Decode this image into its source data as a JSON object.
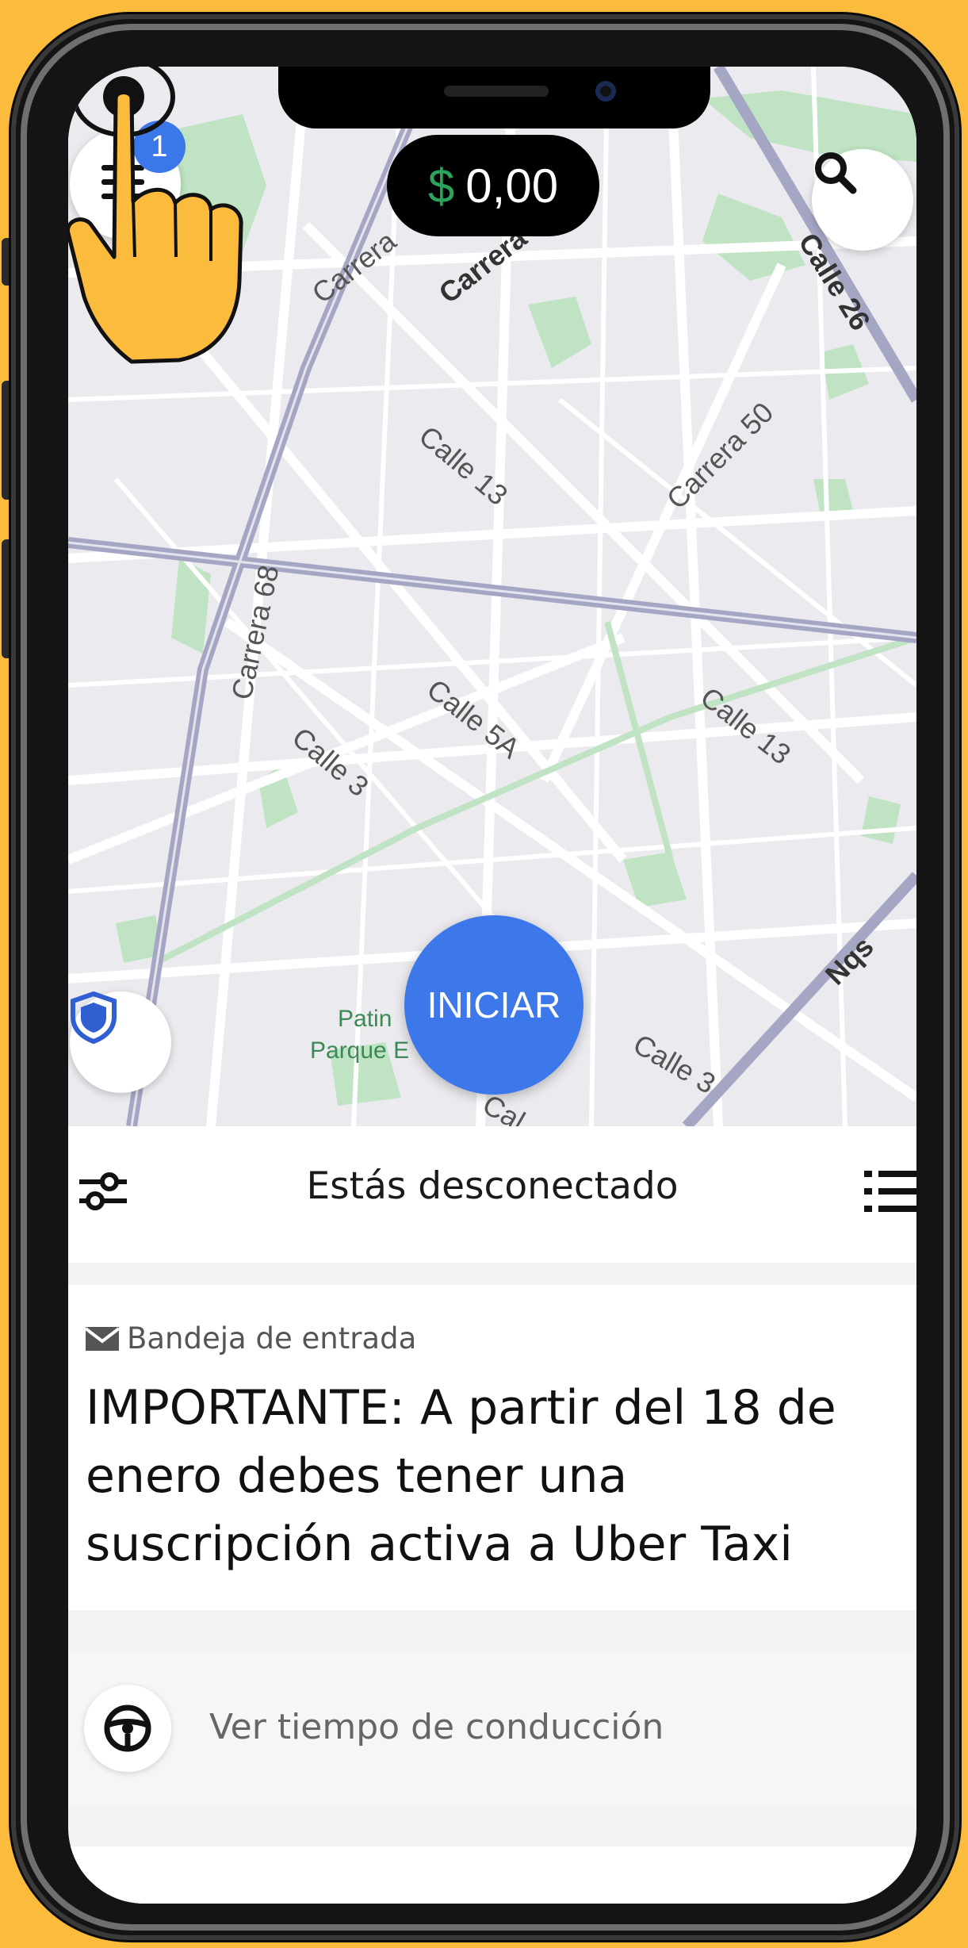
{
  "header": {
    "earnings_currency": "$",
    "earnings_amount": "0,00",
    "notification_count": "1"
  },
  "map": {
    "street_labels": [
      "Carrera",
      "Carrera",
      "Calle 26",
      "Carrera 50",
      "Calle 13",
      "Carrera 68",
      "Calle 5A",
      "Calle 13",
      "Calle 3",
      "Nqs",
      "Calle 3",
      "Patin",
      "Parque E",
      "Cal"
    ],
    "start_button_label": "INICIAR"
  },
  "status": {
    "text": "Estás desconectado"
  },
  "inbox": {
    "label": "Bandeja de entrada",
    "title": "IMPORTANTE: A partir del 18 de enero debes tener una suscripción activa a Uber Taxi"
  },
  "driving_time": {
    "label": "Ver tiempo de conducción"
  },
  "colors": {
    "background": "#fbbc3e",
    "accent_blue": "#3c78ea",
    "money_green": "#2aa35b"
  }
}
